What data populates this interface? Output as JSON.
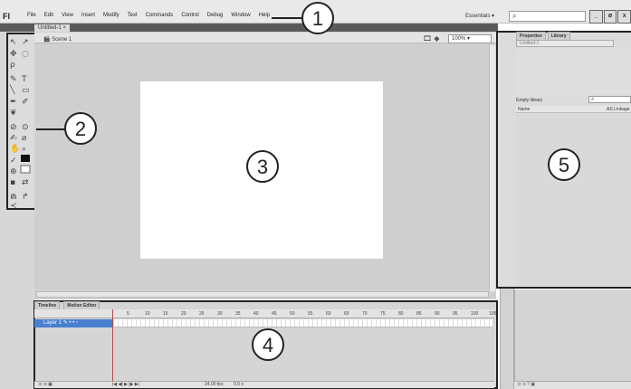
{
  "app": {
    "logo": "Fl",
    "menu": [
      "File",
      "Edit",
      "View",
      "Insert",
      "Modify",
      "Text",
      "Commands",
      "Control",
      "Debug",
      "Window",
      "Help"
    ],
    "workspace": "Essentials",
    "search_icon": "search-icon",
    "window_buttons": [
      "_",
      "ø",
      "x"
    ]
  },
  "document": {
    "tab_label": "Untitled-1",
    "tab_close": "×",
    "scene": "Scene 1",
    "zoom": "100%"
  },
  "timeline": {
    "tabs": [
      "Timeline",
      "Motion Editor"
    ],
    "frame_numbers": [
      "5",
      "10",
      "15",
      "20",
      "25",
      "30",
      "35",
      "40",
      "45",
      "50",
      "55",
      "60",
      "65",
      "70",
      "75",
      "80",
      "85",
      "90",
      "95",
      "100",
      "105"
    ],
    "layer_name": "Layer 1",
    "footer_values": [
      "24.00 fps",
      "0.0 s",
      "1"
    ]
  },
  "library": {
    "tabs": [
      "Properties",
      "Library"
    ],
    "document": "Untitled-1",
    "empty_text": "Empty library",
    "columns": [
      "Name",
      "AS Linkage"
    ]
  },
  "callouts": [
    "1",
    "2",
    "3",
    "4",
    "5"
  ],
  "colors": {
    "menubar": "#e9e9e9",
    "stage_bg": "#cfcfcf",
    "stage": "#ffffff",
    "layer_selected": "#4a7fd0",
    "playhead": "#ee3333"
  }
}
